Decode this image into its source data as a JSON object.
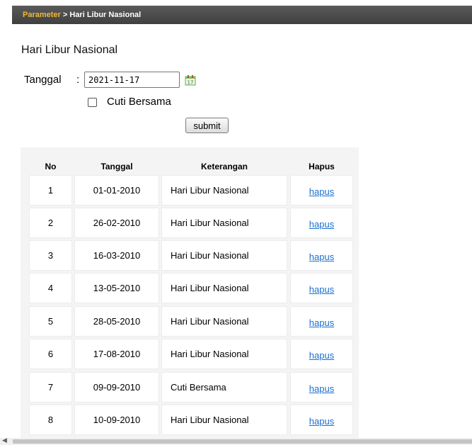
{
  "breadcrumb": {
    "parent": "Parameter",
    "separator": " > ",
    "current": "Hari Libur Nasional"
  },
  "page_title": "Hari Libur Nasional",
  "form": {
    "tanggal_label": "Tanggal",
    "colon": ":",
    "tanggal_value": "2021-11-17",
    "calendar_icon": "calendar-icon",
    "cuti_label": "Cuti Bersama",
    "cuti_checked": false,
    "submit_label": "submit"
  },
  "table": {
    "headers": {
      "no": "No",
      "tanggal": "Tanggal",
      "keterangan": "Keterangan",
      "hapus": "Hapus"
    },
    "rows": [
      {
        "no": "1",
        "tanggal": "01-01-2010",
        "keterangan": "Hari Libur Nasional",
        "action": "hapus"
      },
      {
        "no": "2",
        "tanggal": "26-02-2010",
        "keterangan": "Hari Libur Nasional",
        "action": "hapus"
      },
      {
        "no": "3",
        "tanggal": "16-03-2010",
        "keterangan": "Hari Libur Nasional",
        "action": "hapus"
      },
      {
        "no": "4",
        "tanggal": "13-05-2010",
        "keterangan": "Hari Libur Nasional",
        "action": "hapus"
      },
      {
        "no": "5",
        "tanggal": "28-05-2010",
        "keterangan": "Hari Libur Nasional",
        "action": "hapus"
      },
      {
        "no": "6",
        "tanggal": "17-08-2010",
        "keterangan": "Hari Libur Nasional",
        "action": "hapus"
      },
      {
        "no": "7",
        "tanggal": "09-09-2010",
        "keterangan": "Cuti Bersama",
        "action": "hapus"
      },
      {
        "no": "8",
        "tanggal": "10-09-2010",
        "keterangan": "Hari Libur Nasional",
        "action": "hapus"
      }
    ]
  },
  "colors": {
    "breadcrumb_link": "#f0b83c",
    "link": "#1a6fd1",
    "topbar": "#4a4a4a"
  }
}
